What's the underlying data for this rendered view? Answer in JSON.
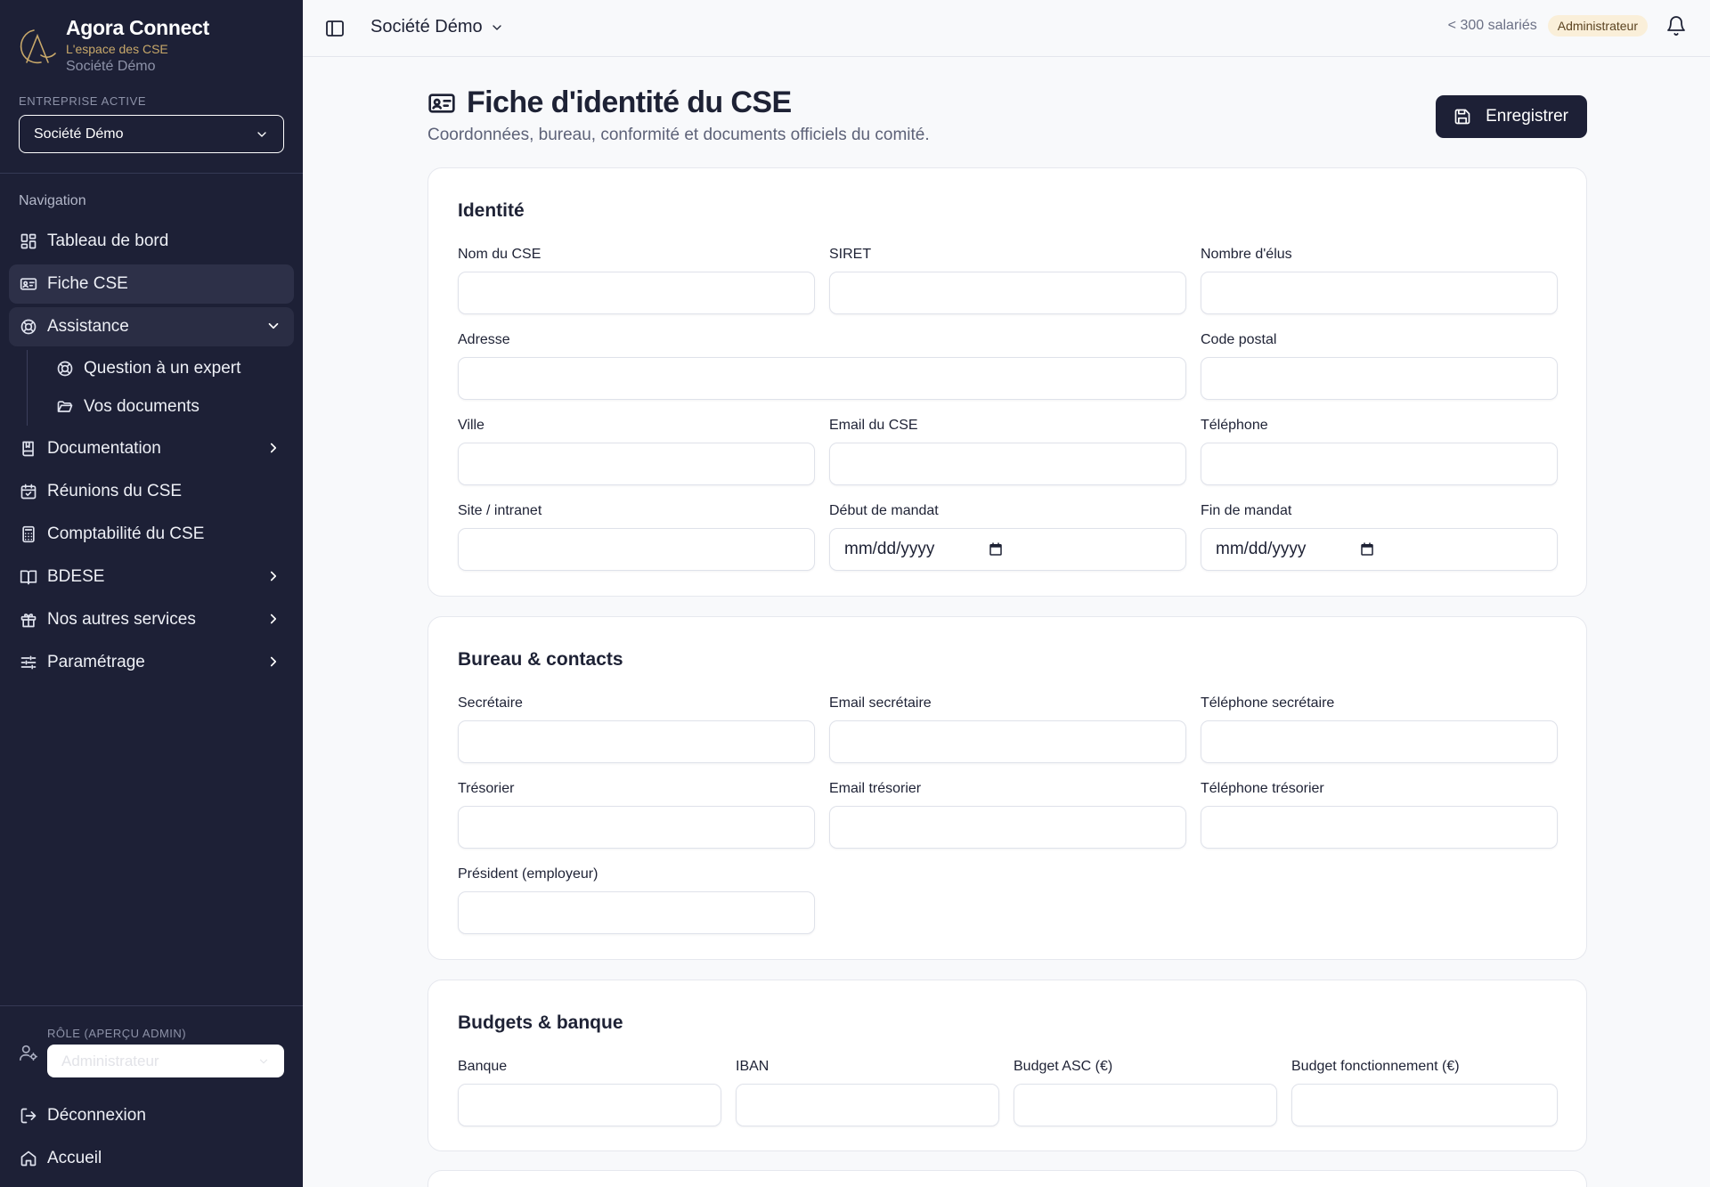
{
  "brand": {
    "name": "Agora Connect",
    "tagline": "L'espace des CSE",
    "company": "Société Démo"
  },
  "sidebar": {
    "company_label": "ENTREPRISE ACTIVE",
    "company_value": "Société Démo",
    "nav_label": "Navigation",
    "items": [
      {
        "label": "Tableau de bord",
        "icon": "dashboard-icon"
      },
      {
        "label": "Fiche CSE",
        "icon": "id-card-icon",
        "active": true
      },
      {
        "label": "Assistance",
        "icon": "lifebuoy-icon",
        "expanded": true,
        "children": [
          {
            "label": "Question à un expert",
            "icon": "lifebuoy-icon"
          },
          {
            "label": "Vos documents",
            "icon": "folder-open-icon"
          }
        ]
      },
      {
        "label": "Documentation",
        "icon": "book-icon"
      },
      {
        "label": "Réunions du CSE",
        "icon": "calendar-check-icon"
      },
      {
        "label": "Comptabilité du CSE",
        "icon": "calculator-icon"
      },
      {
        "label": "BDESE",
        "icon": "book-open-icon"
      },
      {
        "label": "Nos autres services",
        "icon": "gift-icon"
      },
      {
        "label": "Paramétrage",
        "icon": "sliders-icon"
      }
    ],
    "role_label": "RÔLE (APERÇU ADMIN)",
    "role_value": "Administrateur",
    "logout": "Déconnexion",
    "home": "Accueil"
  },
  "topbar": {
    "company": "Société Démo",
    "employee_count": "< 300 salariés",
    "role_badge": "Administrateur"
  },
  "page": {
    "title": "Fiche d'identité du CSE",
    "subtitle": "Coordonnées, bureau, conformité et documents officiels du comité.",
    "save_label": "Enregistrer"
  },
  "sections": {
    "identite": {
      "title": "Identité",
      "fields": {
        "nom": "Nom du CSE",
        "siret": "SIRET",
        "elus": "Nombre d'élus",
        "adresse": "Adresse",
        "cp": "Code postal",
        "ville": "Ville",
        "email": "Email du CSE",
        "tel": "Téléphone",
        "site": "Site / intranet",
        "debut": "Début de mandat",
        "fin": "Fin de mandat"
      },
      "date_placeholder": "mm/dd/yyyy"
    },
    "bureau": {
      "title": "Bureau & contacts",
      "fields": {
        "secretaire": "Secrétaire",
        "email_sec": "Email secrétaire",
        "tel_sec": "Téléphone secrétaire",
        "tresorier": "Trésorier",
        "email_tres": "Email trésorier",
        "tel_tres": "Téléphone trésorier",
        "president": "Président (employeur)"
      }
    },
    "budgets": {
      "title": "Budgets & banque",
      "fields": {
        "banque": "Banque",
        "iban": "IBAN",
        "asc": "Budget ASC (€)",
        "fonctionnement": "Budget fonctionnement (€)"
      }
    }
  },
  "colors": {
    "sidebar_bg": "#1d2036",
    "accent_gold": "#c8a86a",
    "primary_button": "#1d2036",
    "badge_bg": "#faefd9"
  }
}
